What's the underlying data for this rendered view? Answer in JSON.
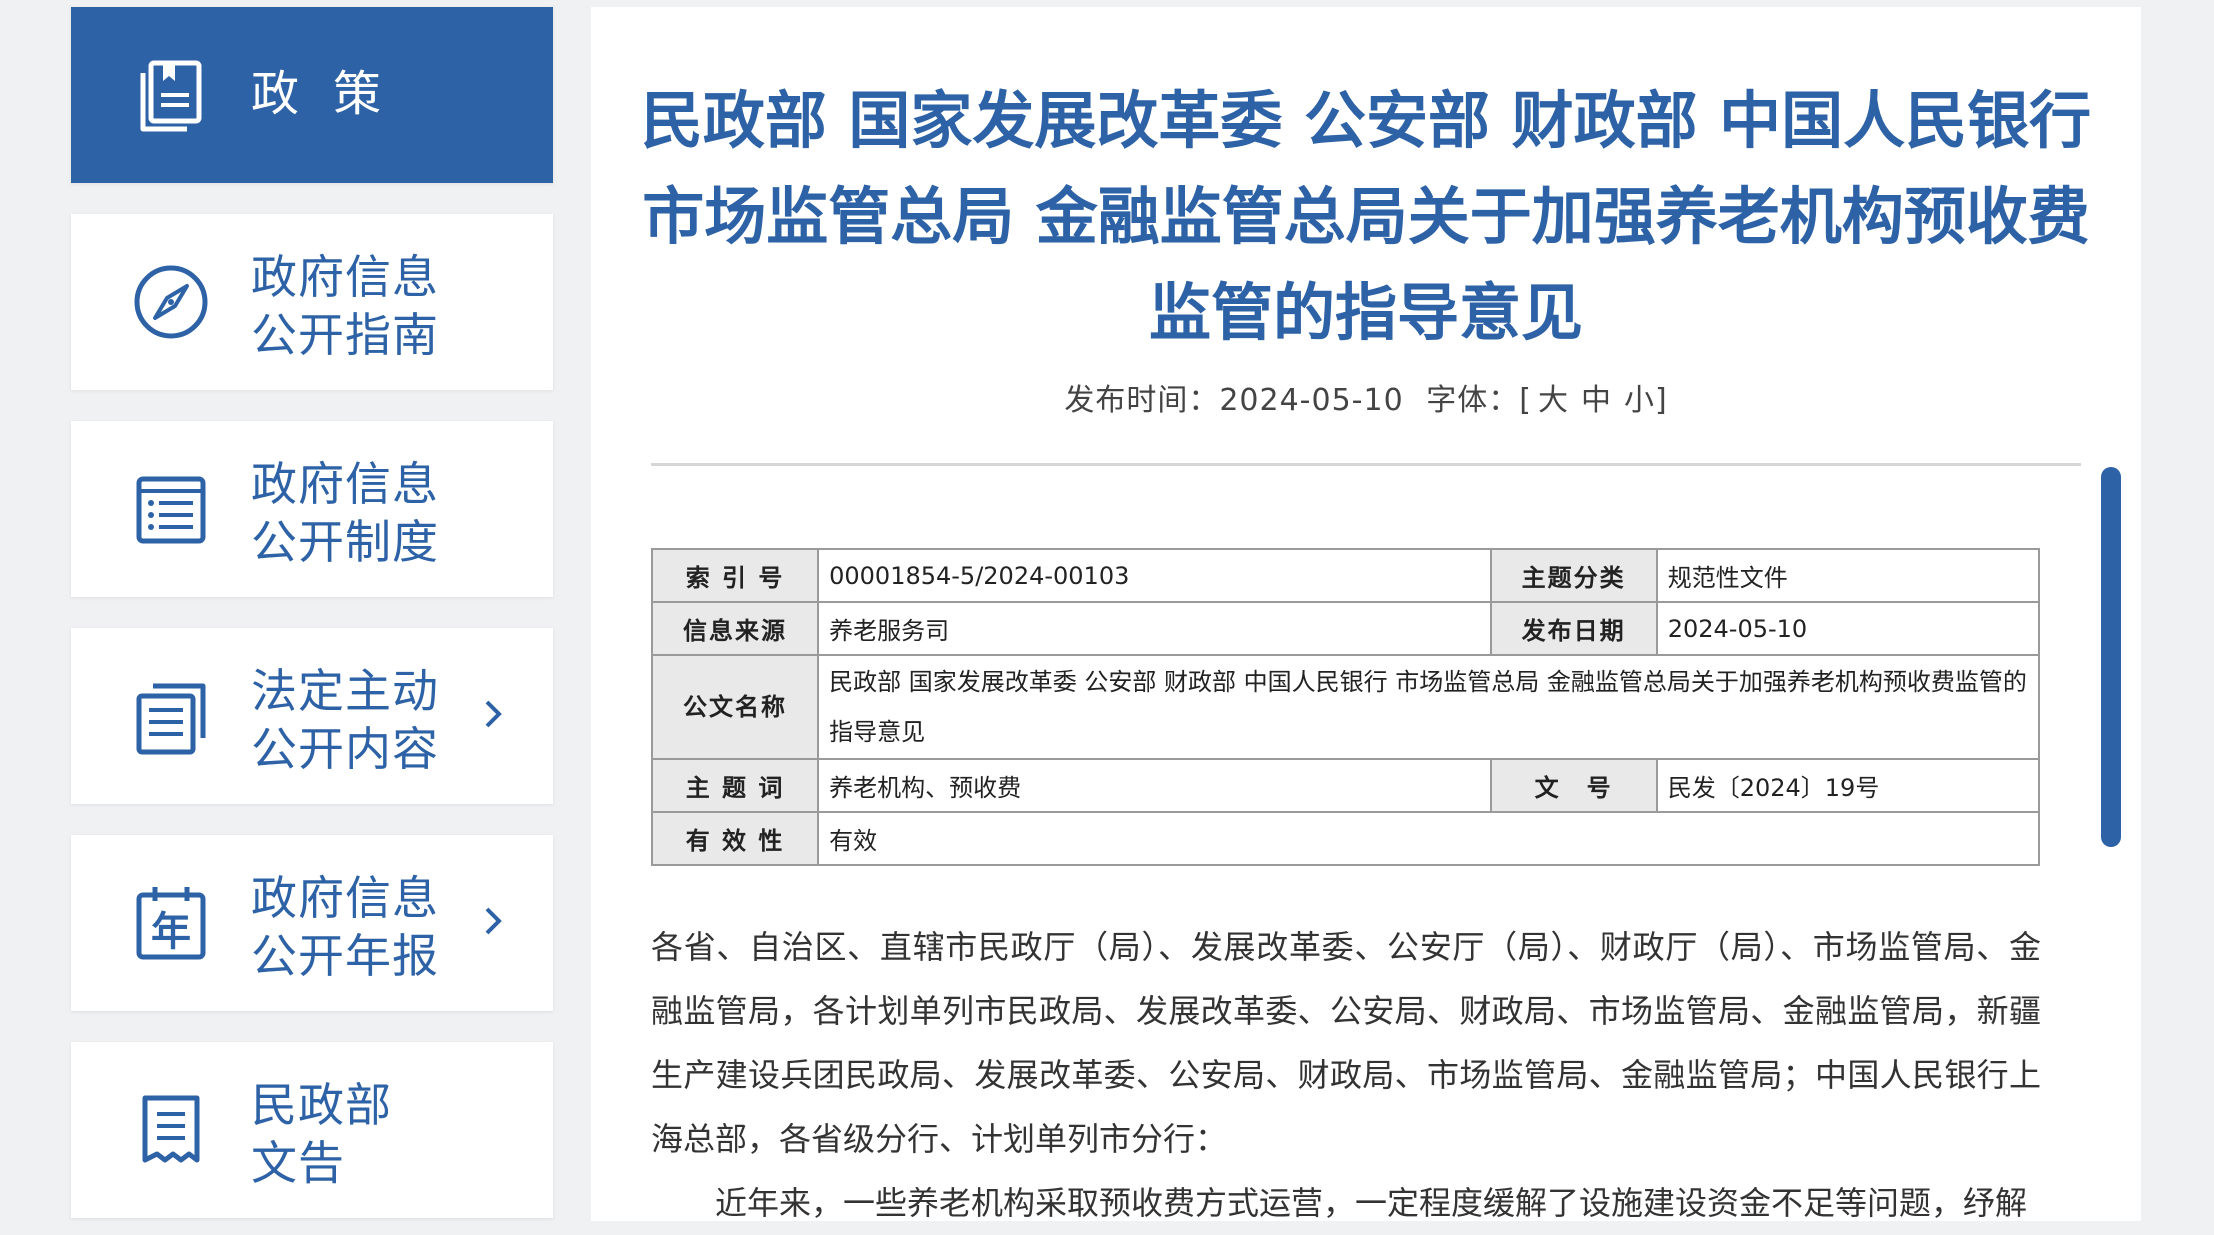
{
  "sidebar": {
    "items": [
      {
        "label_1": "政",
        "label_2": "策",
        "icon": "policy-book-icon",
        "active": true
      },
      {
        "label_1": "政府信息",
        "label_2": "公开指南",
        "icon": "compass-icon"
      },
      {
        "label_1": "政府信息",
        "label_2": "公开制度",
        "icon": "list-document-icon"
      },
      {
        "label_1": "法定主动",
        "label_2": "公开内容",
        "icon": "stacked-documents-icon",
        "has_chevron": true
      },
      {
        "label_1": "政府信息",
        "label_2": "公开年报",
        "icon": "year-calendar-icon",
        "icon_text": "年",
        "has_chevron": true
      },
      {
        "label_1": "民政部",
        "label_2": "文告",
        "icon": "notice-document-icon"
      }
    ],
    "chevron_icon": "chevron-right-icon"
  },
  "article": {
    "title": "民政部 国家发展改革委 公安部 财政部  中国人民银行 市场监管总局 金融监管总局关于加强养老机构预收费监管的指导意见",
    "publish_label": "发布时间：",
    "publish_date": "2024-05-10",
    "font_label": "字体：",
    "font_open": "[",
    "font_large": "大",
    "font_medium": "中",
    "font_small": "小",
    "font_close": "]"
  },
  "info_table": {
    "index_label": "索 引 号",
    "index_value": "00001854-5/2024-00103",
    "category_label": "主题分类",
    "category_value": "规范性文件",
    "source_label": "信息来源",
    "source_value": "养老服务司",
    "date_label": "发布日期",
    "date_value": "2024-05-10",
    "doc_name_label": "公文名称",
    "doc_name_value": "民政部 国家发展改革委 公安部 财政部  中国人民银行 市场监管总局 金融监管总局关于加强养老机构预收费监管的指导意见",
    "keywords_label": "主 题 词",
    "keywords_value": "养老机构、预收费",
    "doc_no_label": "文　号",
    "doc_no_value": "民发〔2024〕19号",
    "validity_label": "有 效 性",
    "validity_value": "有效"
  },
  "body": {
    "paragraph_1": "各省、自治区、直辖市民政厅（局）、发展改革委、公安厅（局）、财政厅（局）、市场监管局、金融监管局，各计划单列市民政局、发展改革委、公安局、财政局、市场监管局、金融监管局，新疆生产建设兵团民政局、发展改革委、公安局、财政局、市场监管局、金融监管局；中国人民银行上海总部，各省级分行、计划单列市分行：",
    "paragraph_2": "近年来，一些养老机构采取预收费方式运营，一定程度缓解了设施建设资金不足等问题，纾解"
  },
  "colors": {
    "primary": "#2e62a6",
    "background": "#f0f1f3",
    "table_header_bg": "#e9e9e9"
  }
}
